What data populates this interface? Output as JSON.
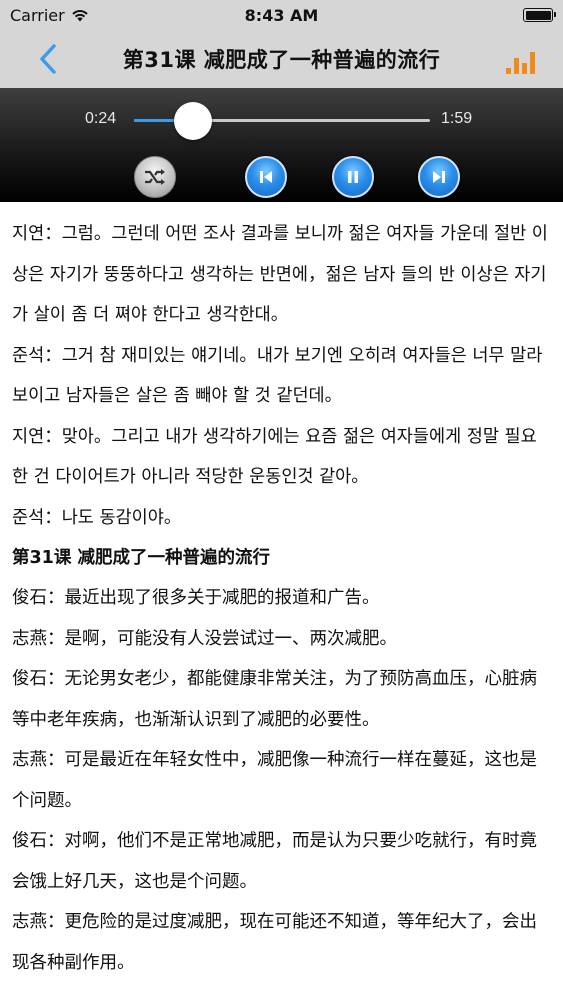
{
  "status_bar": {
    "carrier": "Carrier",
    "time": "8:43 AM"
  },
  "nav": {
    "title": "第31课 减肥成了一种普遍的流行",
    "back_icon": "chevron-left-icon",
    "chart_icon": "bar-chart-icon",
    "accent_color": "#3d9be9",
    "chart_color": "#f28a1a"
  },
  "player": {
    "current_time": "0:24",
    "total_time": "1:59",
    "progress": 0.2
  },
  "content": {
    "korean_lines": [
      "지연：그럼。그런데 어떤 조사 결과를 보니까 젊은 여자들 가운데 절반 이상은 자기가 뚱뚱하다고 생각하는 반면에，젊은 남자 들의 반 이상은 자기가 살이 좀 더 쪄야 한다고 생각한대。",
      "준석：그거 참 재미있는 얘기네。내가 보기엔 오히려 여자들은 너무 말라 보이고 남자들은 살은 좀 빼야 할 것 같던데。",
      "지연：맞아。그리고 내가 생각하기에는 요즘 젊은 여자들에게 정말 필요한 건 다이어트가 아니라 적당한 운동인것 같아。",
      "준석：나도 동감이야。"
    ],
    "section_title": "第31课 减肥成了一种普遍的流行",
    "chinese_lines": [
      "俊石：最近出现了很多关于减肥的报道和广告。",
      "志燕：是啊，可能没有人没尝试过一、两次减肥。",
      "俊石：无论男女老少，都能健康非常关注，为了预防高血压，心脏病等中老年疾病，也渐渐认识到了减肥的必要性。",
      "志燕：可是最近在年轻女性中，减肥像一种流行一样在蔓延，这也是个问题。",
      "俊石：对啊，他们不是正常地减肥，而是认为只要少吃就行，有时竟会饿上好几天，这也是个问题。",
      "志燕：更危险的是过度减肥，现在可能还不知道，等年纪大了，会出现各种副作用。"
    ]
  }
}
